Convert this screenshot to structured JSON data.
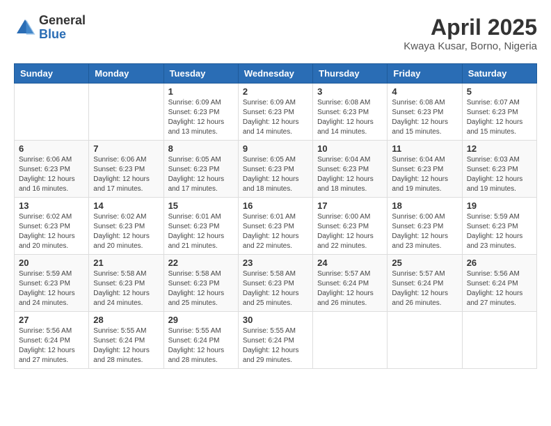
{
  "logo": {
    "general": "General",
    "blue": "Blue"
  },
  "title": {
    "month": "April 2025",
    "location": "Kwaya Kusar, Borno, Nigeria"
  },
  "weekdays": [
    "Sunday",
    "Monday",
    "Tuesday",
    "Wednesday",
    "Thursday",
    "Friday",
    "Saturday"
  ],
  "weeks": [
    [
      {
        "day": "",
        "info": ""
      },
      {
        "day": "",
        "info": ""
      },
      {
        "day": "1",
        "info": "Sunrise: 6:09 AM\nSunset: 6:23 PM\nDaylight: 12 hours and 13 minutes."
      },
      {
        "day": "2",
        "info": "Sunrise: 6:09 AM\nSunset: 6:23 PM\nDaylight: 12 hours and 14 minutes."
      },
      {
        "day": "3",
        "info": "Sunrise: 6:08 AM\nSunset: 6:23 PM\nDaylight: 12 hours and 14 minutes."
      },
      {
        "day": "4",
        "info": "Sunrise: 6:08 AM\nSunset: 6:23 PM\nDaylight: 12 hours and 15 minutes."
      },
      {
        "day": "5",
        "info": "Sunrise: 6:07 AM\nSunset: 6:23 PM\nDaylight: 12 hours and 15 minutes."
      }
    ],
    [
      {
        "day": "6",
        "info": "Sunrise: 6:06 AM\nSunset: 6:23 PM\nDaylight: 12 hours and 16 minutes."
      },
      {
        "day": "7",
        "info": "Sunrise: 6:06 AM\nSunset: 6:23 PM\nDaylight: 12 hours and 17 minutes."
      },
      {
        "day": "8",
        "info": "Sunrise: 6:05 AM\nSunset: 6:23 PM\nDaylight: 12 hours and 17 minutes."
      },
      {
        "day": "9",
        "info": "Sunrise: 6:05 AM\nSunset: 6:23 PM\nDaylight: 12 hours and 18 minutes."
      },
      {
        "day": "10",
        "info": "Sunrise: 6:04 AM\nSunset: 6:23 PM\nDaylight: 12 hours and 18 minutes."
      },
      {
        "day": "11",
        "info": "Sunrise: 6:04 AM\nSunset: 6:23 PM\nDaylight: 12 hours and 19 minutes."
      },
      {
        "day": "12",
        "info": "Sunrise: 6:03 AM\nSunset: 6:23 PM\nDaylight: 12 hours and 19 minutes."
      }
    ],
    [
      {
        "day": "13",
        "info": "Sunrise: 6:02 AM\nSunset: 6:23 PM\nDaylight: 12 hours and 20 minutes."
      },
      {
        "day": "14",
        "info": "Sunrise: 6:02 AM\nSunset: 6:23 PM\nDaylight: 12 hours and 20 minutes."
      },
      {
        "day": "15",
        "info": "Sunrise: 6:01 AM\nSunset: 6:23 PM\nDaylight: 12 hours and 21 minutes."
      },
      {
        "day": "16",
        "info": "Sunrise: 6:01 AM\nSunset: 6:23 PM\nDaylight: 12 hours and 22 minutes."
      },
      {
        "day": "17",
        "info": "Sunrise: 6:00 AM\nSunset: 6:23 PM\nDaylight: 12 hours and 22 minutes."
      },
      {
        "day": "18",
        "info": "Sunrise: 6:00 AM\nSunset: 6:23 PM\nDaylight: 12 hours and 23 minutes."
      },
      {
        "day": "19",
        "info": "Sunrise: 5:59 AM\nSunset: 6:23 PM\nDaylight: 12 hours and 23 minutes."
      }
    ],
    [
      {
        "day": "20",
        "info": "Sunrise: 5:59 AM\nSunset: 6:23 PM\nDaylight: 12 hours and 24 minutes."
      },
      {
        "day": "21",
        "info": "Sunrise: 5:58 AM\nSunset: 6:23 PM\nDaylight: 12 hours and 24 minutes."
      },
      {
        "day": "22",
        "info": "Sunrise: 5:58 AM\nSunset: 6:23 PM\nDaylight: 12 hours and 25 minutes."
      },
      {
        "day": "23",
        "info": "Sunrise: 5:58 AM\nSunset: 6:23 PM\nDaylight: 12 hours and 25 minutes."
      },
      {
        "day": "24",
        "info": "Sunrise: 5:57 AM\nSunset: 6:24 PM\nDaylight: 12 hours and 26 minutes."
      },
      {
        "day": "25",
        "info": "Sunrise: 5:57 AM\nSunset: 6:24 PM\nDaylight: 12 hours and 26 minutes."
      },
      {
        "day": "26",
        "info": "Sunrise: 5:56 AM\nSunset: 6:24 PM\nDaylight: 12 hours and 27 minutes."
      }
    ],
    [
      {
        "day": "27",
        "info": "Sunrise: 5:56 AM\nSunset: 6:24 PM\nDaylight: 12 hours and 27 minutes."
      },
      {
        "day": "28",
        "info": "Sunrise: 5:55 AM\nSunset: 6:24 PM\nDaylight: 12 hours and 28 minutes."
      },
      {
        "day": "29",
        "info": "Sunrise: 5:55 AM\nSunset: 6:24 PM\nDaylight: 12 hours and 28 minutes."
      },
      {
        "day": "30",
        "info": "Sunrise: 5:55 AM\nSunset: 6:24 PM\nDaylight: 12 hours and 29 minutes."
      },
      {
        "day": "",
        "info": ""
      },
      {
        "day": "",
        "info": ""
      },
      {
        "day": "",
        "info": ""
      }
    ]
  ]
}
